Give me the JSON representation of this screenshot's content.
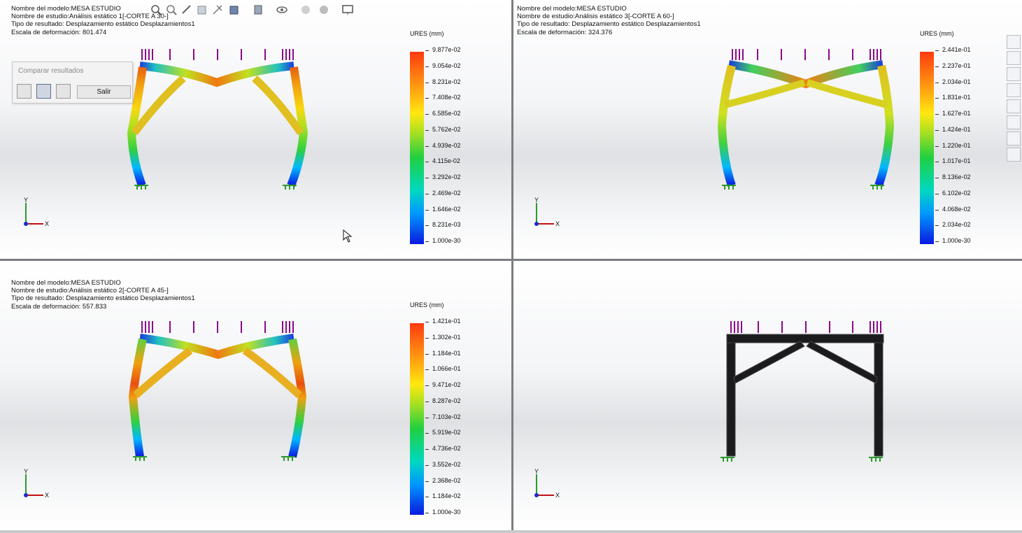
{
  "viewports": [
    {
      "model": "Nombre del modelo:MESA ESTUDIO",
      "study": "Nombre de estudio:Análisis estático 1[-CORTE A 30-]",
      "result": "Tipo de resultado: Desplazamiento estático Desplazamientos1",
      "scale": "Escala de deformación: 801.474",
      "legend_title": "URES (mm)",
      "ticks": [
        "9.877e-02",
        "9.054e-02",
        "8.231e-02",
        "7.408e-02",
        "6.585e-02",
        "5.762e-02",
        "4.939e-02",
        "4.115e-02",
        "3.292e-02",
        "2.469e-02",
        "1.646e-02",
        "8.231e-03",
        "1.000e-30"
      ]
    },
    {
      "model": "Nombre del modelo:MESA ESTUDIO",
      "study": "Nombre de estudio:Análisis estático 3[-CORTE A 60-]",
      "result": "Tipo de resultado: Desplazamiento estático Desplazamientos1",
      "scale": "Escala de deformación: 324.376",
      "legend_title": "URES (mm)",
      "ticks": [
        "2.441e-01",
        "2.237e-01",
        "2.034e-01",
        "1.831e-01",
        "1.627e-01",
        "1.424e-01",
        "1.220e-01",
        "1.017e-01",
        "8.136e-02",
        "6.102e-02",
        "4.068e-02",
        "2.034e-02",
        "1.000e-30"
      ]
    },
    {
      "model": "Nombre del modelo:MESA ESTUDIO",
      "study": "Nombre de estudio:Análisis estático 2[-CORTE A 45-]",
      "result": "Tipo de resultado: Desplazamiento estático Desplazamientos1",
      "scale": "Escala de deformación: 557.833",
      "legend_title": "URES (mm)",
      "ticks": [
        "1.421e-01",
        "1.302e-01",
        "1.184e-01",
        "1.066e-01",
        "9.471e-02",
        "8.287e-02",
        "7.103e-02",
        "5.919e-02",
        "4.736e-02",
        "3.552e-02",
        "2.368e-02",
        "1.184e-02",
        "1.000e-30"
      ]
    }
  ],
  "compare_dialog": {
    "title": "Comparar resultados",
    "exit_label": "Salir"
  },
  "axis": {
    "x": "X",
    "y": "Y"
  }
}
